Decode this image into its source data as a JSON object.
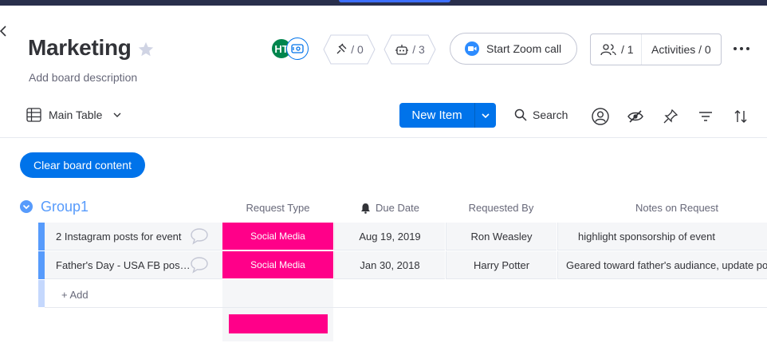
{
  "board": {
    "title": "Marketing",
    "description": "Add board description"
  },
  "header": {
    "avatar_initials": "HT",
    "integrations_count": "/ 0",
    "automations_count": "/ 3",
    "zoom_label": "Start Zoom call",
    "members_count": "/ 1",
    "activities_label": "Activities / 0"
  },
  "toolbar": {
    "view_label": "Main Table",
    "new_item_label": "New Item",
    "search_label": "Search"
  },
  "clear_button_label": "Clear board content",
  "group": {
    "title": "Group1",
    "color": "#579bfc",
    "columns": {
      "request_type": "Request Type",
      "due_date": "Due Date",
      "requested_by": "Requested By",
      "notes": "Notes on Request"
    },
    "rows": [
      {
        "name": "2 Instagram posts for event",
        "request_type": "Social Media",
        "due_date": "Aug 19, 2019",
        "requested_by": "Ron Weasley",
        "notes": "highlight sponsorship of event"
      },
      {
        "name": "Father's Day - USA FB post…",
        "request_type": "Social Media",
        "due_date": "Jan 30, 2018",
        "requested_by": "Harry Potter",
        "notes": "Geared toward father's audiance, update pos"
      }
    ],
    "add_label": "+ Add"
  },
  "colors": {
    "accent": "#0073ea",
    "status_social_media": "#ff0089"
  }
}
